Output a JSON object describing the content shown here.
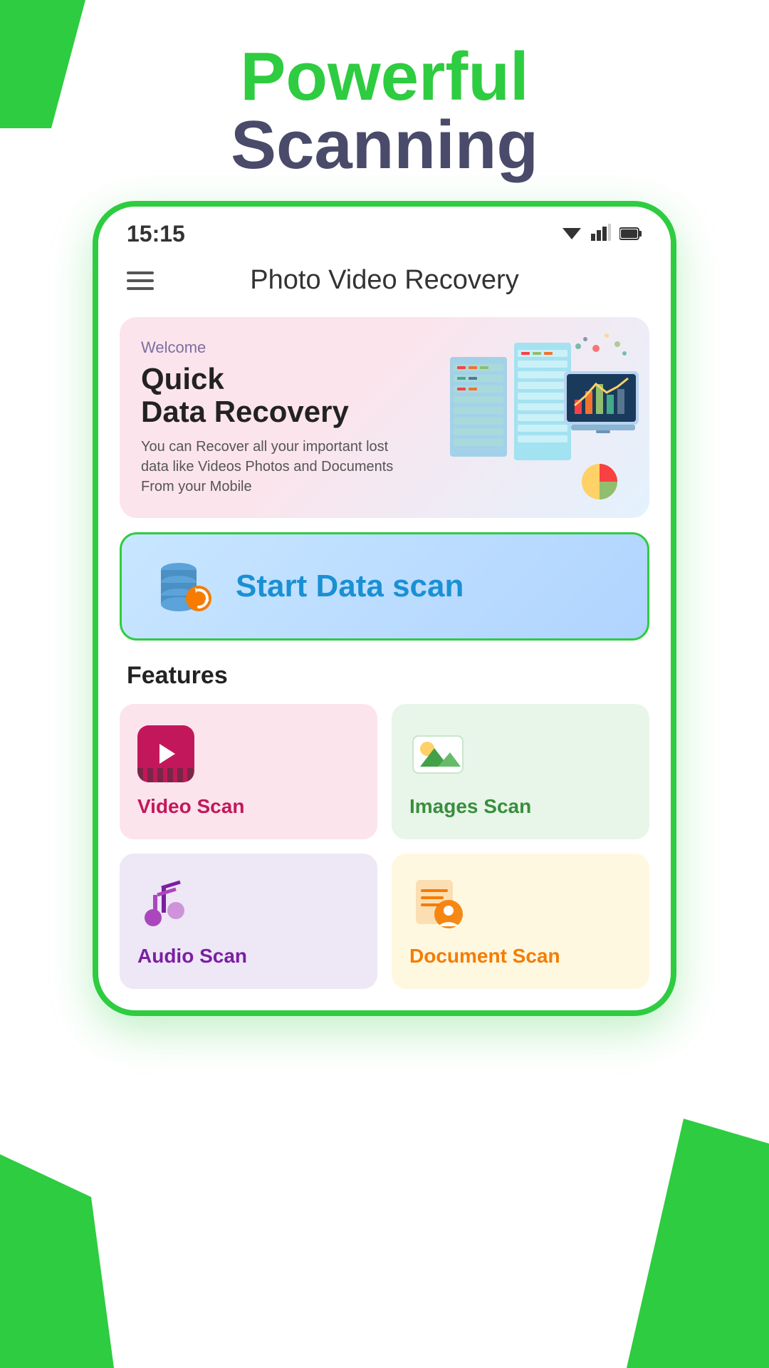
{
  "header": {
    "title_line1": "Powerful",
    "title_line2": "Scanning"
  },
  "status_bar": {
    "time": "15:15",
    "wifi_icon": "▲",
    "signal_icon": "▲",
    "battery_icon": "▮"
  },
  "app": {
    "title": "Photo Video Recovery"
  },
  "banner": {
    "welcome_label": "Welcome",
    "title_line1": "Quick",
    "title_line2": "Data Recovery",
    "description": "You can Recover all your important lost data like Videos Photos and Documents From your Mobile"
  },
  "start_scan": {
    "label": "Start Data scan"
  },
  "features": {
    "section_title": "Features",
    "items": [
      {
        "id": "video",
        "label": "Video Scan",
        "icon_type": "video",
        "bg_color": "#fce4ec",
        "label_color": "#c2185b"
      },
      {
        "id": "images",
        "label": "Images Scan",
        "icon_type": "images",
        "bg_color": "#e8f5e9",
        "label_color": "#388e3c"
      },
      {
        "id": "audio",
        "label": "Audio Scan",
        "icon_type": "audio",
        "bg_color": "#ede7f6",
        "label_color": "#7b1fa2"
      },
      {
        "id": "document",
        "label": "Document Scan",
        "icon_type": "document",
        "bg_color": "#fff8e1",
        "label_color": "#f57c00"
      }
    ]
  },
  "colors": {
    "accent_green": "#2ecc40",
    "header_purple": "#4a4a6a"
  }
}
